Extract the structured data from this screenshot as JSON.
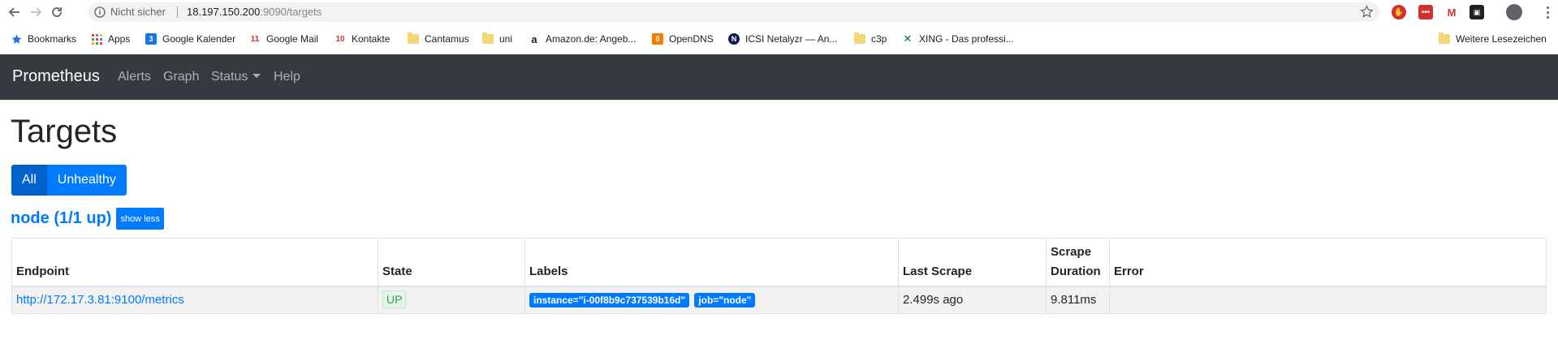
{
  "browser": {
    "security_label": "Nicht sicher",
    "url_host": "18.197.150.200",
    "url_rest": ":9090/targets",
    "bookmarks": [
      {
        "label": "Bookmarks",
        "icon": "star-icon"
      },
      {
        "label": "Apps",
        "icon": "apps-grid-icon"
      },
      {
        "label": "Google Kalender",
        "icon": "calendar-icon"
      },
      {
        "label": "Google Mail",
        "icon": "gmail-icon"
      },
      {
        "label": "Kontakte",
        "icon": "contacts-icon"
      },
      {
        "label": "Cantamus",
        "icon": "folder-icon"
      },
      {
        "label": "uni",
        "icon": "folder-icon"
      },
      {
        "label": "Amazon.de: Angeb...",
        "icon": "amazon-icon"
      },
      {
        "label": "OpenDNS",
        "icon": "opendns-icon"
      },
      {
        "label": "ICSI Netalyzr — An...",
        "icon": "netalyzr-icon"
      },
      {
        "label": "c3p",
        "icon": "folder-icon"
      },
      {
        "label": "XING - Das professi...",
        "icon": "xing-icon"
      }
    ],
    "other_bookmarks": "Weitere Lesezeichen",
    "calendar_day": "3",
    "contacts_day": "10",
    "gmail_day": "11"
  },
  "navbar": {
    "brand": "Prometheus",
    "links": [
      "Alerts",
      "Graph",
      "Status",
      "Help"
    ]
  },
  "page": {
    "title": "Targets",
    "filter_all": "All",
    "filter_unhealthy": "Unhealthy",
    "job_title": "node (1/1 up)",
    "show_less": "show less"
  },
  "table": {
    "headers": [
      "Endpoint",
      "State",
      "Labels",
      "Last Scrape",
      "Scrape Duration",
      "Error"
    ],
    "header_scrape_duration_line1": "Scrape",
    "header_scrape_duration_line2": "Duration",
    "rows": [
      {
        "endpoint": "http://172.17.3.81:9100/metrics",
        "state": "UP",
        "labels": [
          "instance=\"i-00f8b9c737539b16d\"",
          "job=\"node\""
        ],
        "last_scrape": "2.499s ago",
        "scrape_duration": "9.811ms",
        "error": ""
      }
    ]
  },
  "colors": {
    "navbar_bg": "#343a40",
    "primary": "#007bff",
    "state_up": "#28a745"
  }
}
